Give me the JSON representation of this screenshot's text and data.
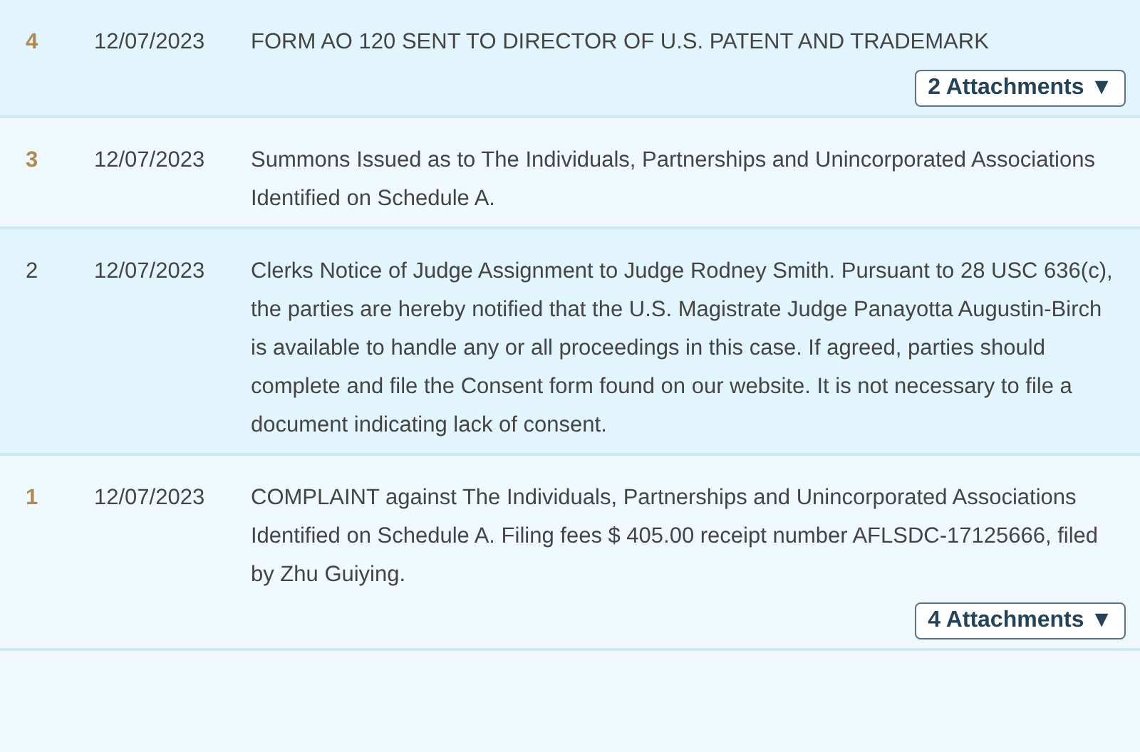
{
  "entries": [
    {
      "number": "4",
      "linked": true,
      "date": "12/07/2023",
      "text": "FORM AO 120 SENT TO DIRECTOR OF U.S. PATENT AND TRADEMARK",
      "attachments": "2 Attachments ▼"
    },
    {
      "number": "3",
      "linked": true,
      "date": "12/07/2023",
      "text": "Summons Issued as to The Individuals, Partnerships and Unincorporated Associations Identified on Schedule A."
    },
    {
      "number": "2",
      "linked": false,
      "date": "12/07/2023",
      "text": "Clerks Notice of Judge Assignment to Judge Rodney Smith. Pursuant to 28 USC 636(c), the parties are hereby notified that the U.S. Magistrate Judge Panayotta Augustin-Birch is available to handle any or all proceedings in this case. If agreed, parties should complete and file the Consent form found on our website. It is not necessary to file a document indicating lack of consent."
    },
    {
      "number": "1",
      "linked": true,
      "date": "12/07/2023",
      "text": "COMPLAINT against The Individuals, Partnerships and Unincorporated Associations Identified on Schedule A. Filing fees $ 405.00 receipt number AFLSDC-17125666, filed by Zhu Guiying.",
      "attachments": "4 Attachments ▼"
    }
  ]
}
